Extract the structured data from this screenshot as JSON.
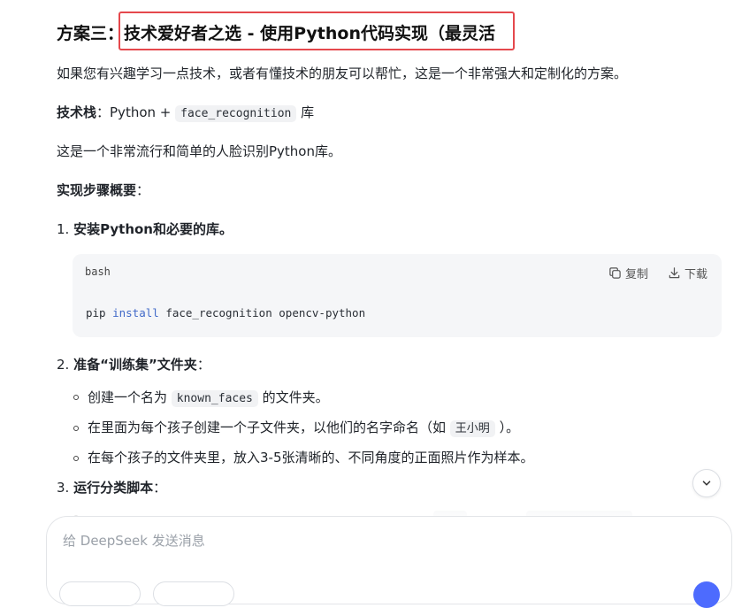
{
  "heading": {
    "prefix": "方案三：",
    "highlight": "技术爱好者之选 - 使用Python代码实现（最灵活"
  },
  "intro": "如果您有兴趣学习一点技术，或者有懂技术的朋友可以帮忙，这是一个非常强大和定制化的方案。",
  "tech_stack": {
    "label": "技术栈",
    "sep": "：Python + ",
    "code": "face_recognition",
    "suffix": " 库"
  },
  "tech_desc": "这是一个非常流行和简单的人脸识别Python库。",
  "steps_title": "实现步骤概要",
  "steps_colon": "：",
  "step1": {
    "num": "1.",
    "title": "安装Python和必要的库。"
  },
  "codeblock": {
    "lang": "bash",
    "copy_label": "复制",
    "download_label": "下载",
    "cmd": "pip",
    "keyword": "install",
    "args": "face_recognition opencv-python"
  },
  "step2": {
    "num": "2.",
    "title": "准备“训练集”文件夹",
    "colon": "：",
    "bullets": [
      {
        "pre": "创建一个名为 ",
        "code": "known_faces",
        "post": " 的文件夹。"
      },
      {
        "pre": "在里面为每个孩子创建一个子文件夹，以他们的名字命名（如 ",
        "code": "王小明",
        "post": " ）。"
      },
      {
        "pre": "在每个孩子的文件夹里，放入3-5张清晰的、不同角度的正面照片作为样本。"
      }
    ]
  },
  "step3": {
    "num": "3.",
    "title": "运行分类脚本",
    "colon": "："
  },
  "input": {
    "placeholder": "给 DeepSeek 发送消息"
  },
  "icons": {
    "copy": "copy-icon",
    "download": "download-icon",
    "scroll_down": "chevron-down-icon"
  }
}
